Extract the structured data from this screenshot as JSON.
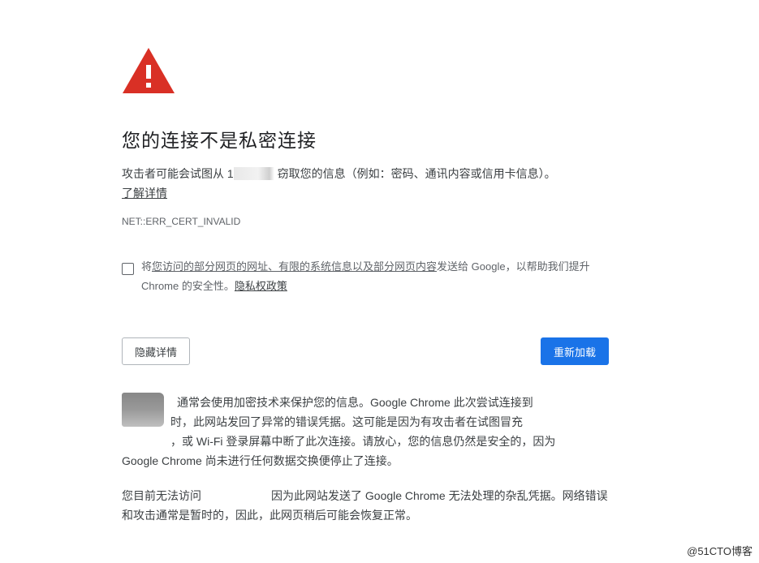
{
  "heading": "您的连接不是私密连接",
  "message": {
    "before": "攻击者可能会试图从 1",
    "after": " 窃取您的信息（例如：密码、通讯内容或信用卡信息）。"
  },
  "learn_more": "了解详情",
  "error_code": "NET::ERR_CERT_INVALID",
  "opt_in": {
    "prefix": "将",
    "link1": "您访问的部分网页的网址、有限的系统信息以及部分网页内容",
    "middle": "发送给 Google，以帮助我们提升 Chrome 的安全性。",
    "privacy_link": "隐私权政策"
  },
  "buttons": {
    "details": "隐藏详情",
    "reload": "重新加载"
  },
  "details": {
    "para1_line1": "通常会使用加密技术来保护您的信息。Google Chrome 此次尝试连接到",
    "para1_line2": "时，此网站发回了异常的错误凭据。这可能是因为有攻击者在试图冒充",
    "para1_line3": "，或 Wi-Fi 登录屏幕中断了此次连接。请放心，您的信息仍然是安全的，因为",
    "para1_line4": "Google Chrome 尚未进行任何数据交换便停止了连接。",
    "para2_before": "您目前无法访问",
    "para2_after": "因为此网站发送了 Google Chrome 无法处理的杂乱凭据。网络错误和攻击通常是暂时的，因此，此网页稍后可能会恢复正常。"
  },
  "watermark": "@51CTO博客",
  "colors": {
    "warning_red": "#d93025",
    "primary_blue": "#1a73e8"
  }
}
